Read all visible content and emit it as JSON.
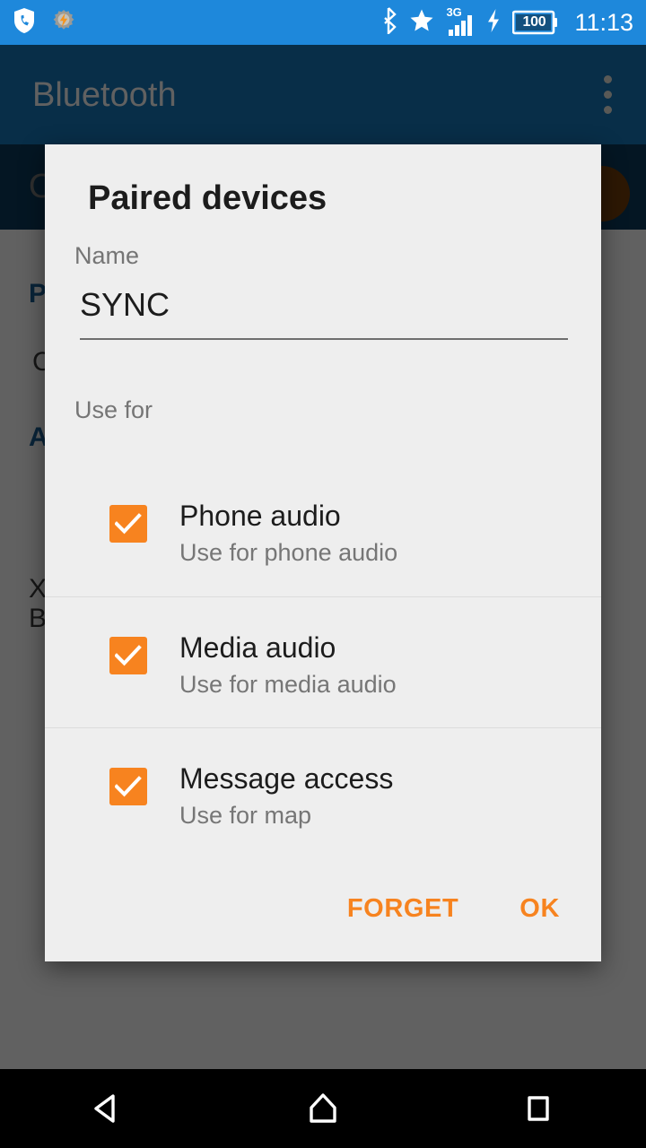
{
  "status_bar": {
    "left_icons": [
      "call-shield-icon",
      "gear-bolt-icon"
    ],
    "right_icons": [
      "bluetooth-icon",
      "priority-star-icon",
      "signal-3g-icon",
      "charging-bolt-icon"
    ],
    "network_label": "3G",
    "battery_level": "100",
    "clock": "11:13",
    "background_color": "#1e88db"
  },
  "app_bar": {
    "title": "Bluetooth",
    "overflow_label": "more-options",
    "background_color": "#0b3c5d"
  },
  "background_screen": {
    "toggle_row_label": "O",
    "paired_heading": "P",
    "paired_item": "C",
    "available_heading": "A",
    "line_x": "X",
    "line_b": "B"
  },
  "dialog": {
    "title": "Paired devices",
    "name_label": "Name",
    "name_value": "SYNC",
    "name_placeholder": "Name",
    "use_for_label": "Use for",
    "options": [
      {
        "title": "Phone audio",
        "subtitle": "Use for phone audio",
        "checked": true
      },
      {
        "title": "Media audio",
        "subtitle": "Use for media audio",
        "checked": true
      },
      {
        "title": "Message access",
        "subtitle": "Use for map",
        "checked": true
      }
    ],
    "forget_label": "FORGET",
    "ok_label": "OK",
    "accent_color": "#f7831f",
    "background_color": "#eeeeee"
  },
  "nav_bar": {
    "back_label": "Back",
    "home_label": "Home",
    "recents_label": "Recent apps",
    "background_color": "#000000"
  }
}
